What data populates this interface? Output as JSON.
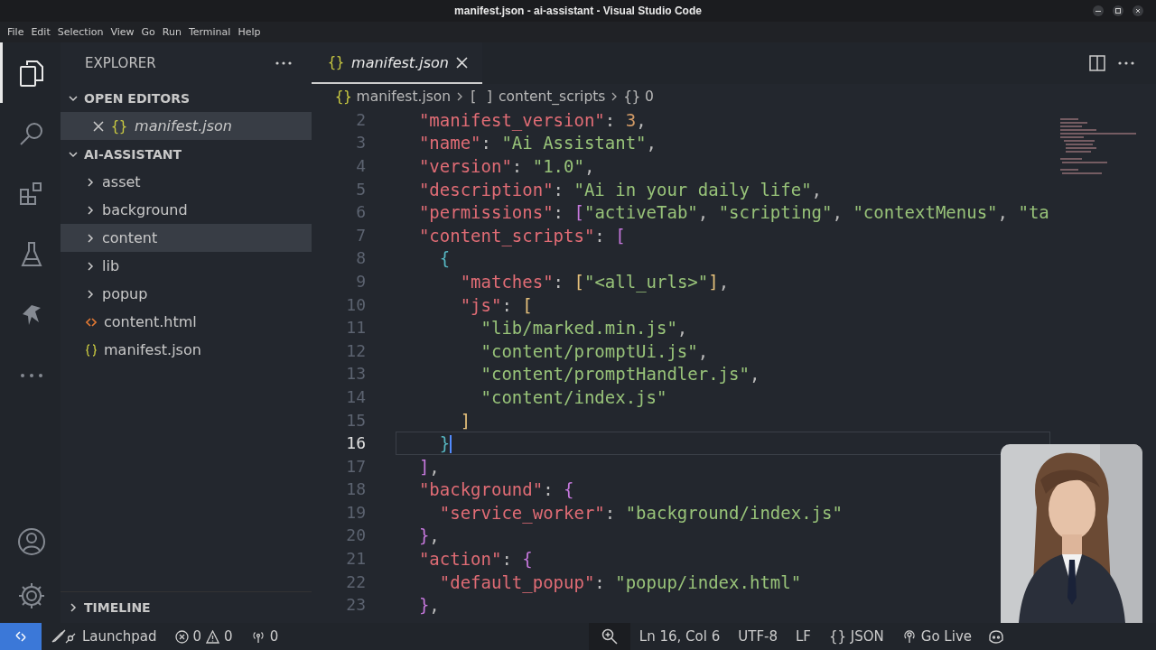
{
  "window": {
    "title": "manifest.json - ai-assistant - Visual Studio Code"
  },
  "menu": [
    "File",
    "Edit",
    "Selection",
    "View",
    "Go",
    "Run",
    "Terminal",
    "Help"
  ],
  "activity_bar": [
    {
      "kind": "explorer",
      "selected": true
    },
    {
      "kind": "search",
      "selected": false
    },
    {
      "kind": "extensions",
      "selected": false
    },
    {
      "kind": "testing",
      "selected": false
    },
    {
      "kind": "bird",
      "selected": false
    },
    {
      "kind": "more",
      "selected": false
    }
  ],
  "activity_bottom": [
    {
      "kind": "account"
    },
    {
      "kind": "settings"
    }
  ],
  "sidebar": {
    "title": "EXPLORER",
    "open_editors": {
      "label": "OPEN EDITORS",
      "expanded": true,
      "items": [
        {
          "icon": "{}",
          "name": "manifest.json",
          "selected": true
        }
      ]
    },
    "folder": {
      "label": "AI-ASSISTANT",
      "expanded": true,
      "items": [
        {
          "kind": "folder",
          "name": "asset",
          "selected": false
        },
        {
          "kind": "folder",
          "name": "background",
          "selected": false
        },
        {
          "kind": "folder",
          "name": "content",
          "selected": true
        },
        {
          "kind": "folder",
          "name": "lib",
          "selected": false
        },
        {
          "kind": "folder",
          "name": "popup",
          "selected": false
        },
        {
          "kind": "html",
          "name": "content.html",
          "selected": false
        },
        {
          "kind": "json",
          "name": "manifest.json",
          "selected": false
        }
      ]
    },
    "timeline": {
      "label": "TIMELINE",
      "expanded": false
    }
  },
  "tabs": [
    {
      "icon": "{}",
      "label": "manifest.json",
      "selected": true
    }
  ],
  "breadcrumbs": [
    {
      "icon": "{}",
      "label": "manifest.json"
    },
    {
      "icon": "[ ]",
      "label": "content_scripts"
    },
    {
      "icon": "{}",
      "label": "0"
    }
  ],
  "editor": {
    "lines": [
      {
        "number": "2",
        "active": false,
        "tokens": [
          {
            "kind": "key",
            "t": "  \"manifest_version\""
          },
          {
            "kind": "punct",
            "t": ": "
          },
          {
            "kind": "number",
            "t": "3"
          },
          {
            "kind": "punct",
            "t": ","
          }
        ]
      },
      {
        "number": "3",
        "active": false,
        "tokens": [
          {
            "kind": "key",
            "t": "  \"name\""
          },
          {
            "kind": "punct",
            "t": ": "
          },
          {
            "kind": "string",
            "t": "\"Ai Assistant\""
          },
          {
            "kind": "punct",
            "t": ","
          }
        ]
      },
      {
        "number": "4",
        "active": false,
        "tokens": [
          {
            "kind": "key",
            "t": "  \"version\""
          },
          {
            "kind": "punct",
            "t": ": "
          },
          {
            "kind": "string",
            "t": "\"1.0\""
          },
          {
            "kind": "punct",
            "t": ","
          }
        ]
      },
      {
        "number": "5",
        "active": false,
        "tokens": [
          {
            "kind": "key",
            "t": "  \"description\""
          },
          {
            "kind": "punct",
            "t": ": "
          },
          {
            "kind": "string",
            "t": "\"Ai in your daily life\""
          },
          {
            "kind": "punct",
            "t": ","
          }
        ]
      },
      {
        "number": "6",
        "active": false,
        "tokens": [
          {
            "kind": "key",
            "t": "  \"permissions\""
          },
          {
            "kind": "punct",
            "t": ": "
          },
          {
            "kind": "bracket1",
            "t": "["
          },
          {
            "kind": "string",
            "t": "\"activeTab\""
          },
          {
            "kind": "punct",
            "t": ", "
          },
          {
            "kind": "string",
            "t": "\"scripting\""
          },
          {
            "kind": "punct",
            "t": ", "
          },
          {
            "kind": "string",
            "t": "\"contextMenus\""
          },
          {
            "kind": "punct",
            "t": ", "
          },
          {
            "kind": "string",
            "t": "\"ta"
          }
        ]
      },
      {
        "number": "7",
        "active": false,
        "tokens": [
          {
            "kind": "key",
            "t": "  \"content_scripts\""
          },
          {
            "kind": "punct",
            "t": ": "
          },
          {
            "kind": "bracket1",
            "t": "["
          }
        ]
      },
      {
        "number": "8",
        "active": false,
        "tokens": [
          {
            "kind": "bracket2",
            "t": "    {"
          }
        ]
      },
      {
        "number": "9",
        "active": false,
        "tokens": [
          {
            "kind": "key",
            "t": "      \"matches\""
          },
          {
            "kind": "punct",
            "t": ": "
          },
          {
            "kind": "bracket3",
            "t": "["
          },
          {
            "kind": "string",
            "t": "\"<all_urls>\""
          },
          {
            "kind": "bracket3",
            "t": "]"
          },
          {
            "kind": "punct",
            "t": ","
          }
        ]
      },
      {
        "number": "10",
        "active": false,
        "tokens": [
          {
            "kind": "key",
            "t": "      \"js\""
          },
          {
            "kind": "punct",
            "t": ": "
          },
          {
            "kind": "bracket3",
            "t": "["
          }
        ]
      },
      {
        "number": "11",
        "active": false,
        "tokens": [
          {
            "kind": "string",
            "t": "        \"lib/marked.min.js\""
          },
          {
            "kind": "punct",
            "t": ","
          }
        ]
      },
      {
        "number": "12",
        "active": false,
        "tokens": [
          {
            "kind": "string",
            "t": "        \"content/promptUi.js\""
          },
          {
            "kind": "punct",
            "t": ","
          }
        ]
      },
      {
        "number": "13",
        "active": false,
        "tokens": [
          {
            "kind": "string",
            "t": "        \"content/promptHandler.js\""
          },
          {
            "kind": "punct",
            "t": ","
          }
        ]
      },
      {
        "number": "14",
        "active": false,
        "tokens": [
          {
            "kind": "string",
            "t": "        \"content/index.js\""
          }
        ]
      },
      {
        "number": "15",
        "active": false,
        "tokens": [
          {
            "kind": "bracket3",
            "t": "      ]"
          }
        ]
      },
      {
        "number": "16",
        "active": true,
        "tokens": [
          {
            "kind": "bracket2",
            "t": "    }"
          }
        ]
      },
      {
        "number": "17",
        "active": false,
        "tokens": [
          {
            "kind": "bracket1",
            "t": "  ]"
          },
          {
            "kind": "punct",
            "t": ","
          }
        ]
      },
      {
        "number": "18",
        "active": false,
        "tokens": [
          {
            "kind": "key",
            "t": "  \"background\""
          },
          {
            "kind": "punct",
            "t": ": "
          },
          {
            "kind": "bracket1",
            "t": "{"
          }
        ]
      },
      {
        "number": "19",
        "active": false,
        "tokens": [
          {
            "kind": "key",
            "t": "    \"service_worker\""
          },
          {
            "kind": "punct",
            "t": ": "
          },
          {
            "kind": "string",
            "t": "\"background/index.js\""
          }
        ]
      },
      {
        "number": "20",
        "active": false,
        "tokens": [
          {
            "kind": "bracket1",
            "t": "  }"
          },
          {
            "kind": "punct",
            "t": ","
          }
        ]
      },
      {
        "number": "21",
        "active": false,
        "tokens": [
          {
            "kind": "key",
            "t": "  \"action\""
          },
          {
            "kind": "punct",
            "t": ": "
          },
          {
            "kind": "bracket1",
            "t": "{"
          }
        ]
      },
      {
        "number": "22",
        "active": false,
        "tokens": [
          {
            "kind": "key",
            "t": "    \"default_popup\""
          },
          {
            "kind": "punct",
            "t": ": "
          },
          {
            "kind": "string",
            "t": "\"popup/index.html\""
          }
        ]
      },
      {
        "number": "23",
        "active": false,
        "tokens": [
          {
            "kind": "bracket1",
            "t": "  }"
          },
          {
            "kind": "punct",
            "t": ","
          }
        ]
      }
    ]
  },
  "status_bar": {
    "launchpad": "Launchpad",
    "errors": "0",
    "warnings": "0",
    "ports": "0",
    "position": "Ln 16, Col 6",
    "encoding": "UTF-8",
    "eol": "LF",
    "language_icon": "{}",
    "language": "JSON",
    "go_live": "Go Live"
  }
}
